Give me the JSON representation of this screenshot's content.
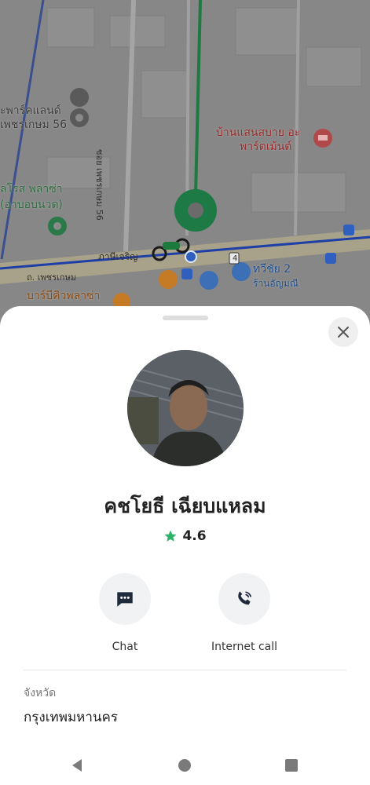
{
  "map": {
    "labels": {
      "park_land_l1": "ะพาร์คแลนด์",
      "park_land_l2": "เพชรเกษม 56",
      "soi_label": "ซอย เพชรเกษม 56",
      "baan_l1": "บ้านแสนสบาย อะ",
      "baan_l2": "พาร์ตเม้นต์",
      "rose_l1": "ลโรส พลาซ่า",
      "rose_l2": "(อาบอบนวด)",
      "kanchanaburi": "ภาษีเจริญ",
      "tawee_l1": "ทวีชัย 2",
      "tawee_l2": "ร้านอัญมณี",
      "phetkasem": "ถ. เพชรเกษม",
      "bar_label": "บาร์บีคิวพลาซ่า",
      "road_number": "4"
    }
  },
  "driver": {
    "name": "คชโยธี เฉียบแหลม",
    "rating": "4.6"
  },
  "actions": {
    "chat_label": "Chat",
    "call_label": "Internet call"
  },
  "info": {
    "province_label": "จังหวัด",
    "province_value": "กรุงเทพมหานคร"
  },
  "colors": {
    "accent_green": "#1f8a4c",
    "star": "#2fb36a",
    "route_blue": "#2050c0"
  }
}
